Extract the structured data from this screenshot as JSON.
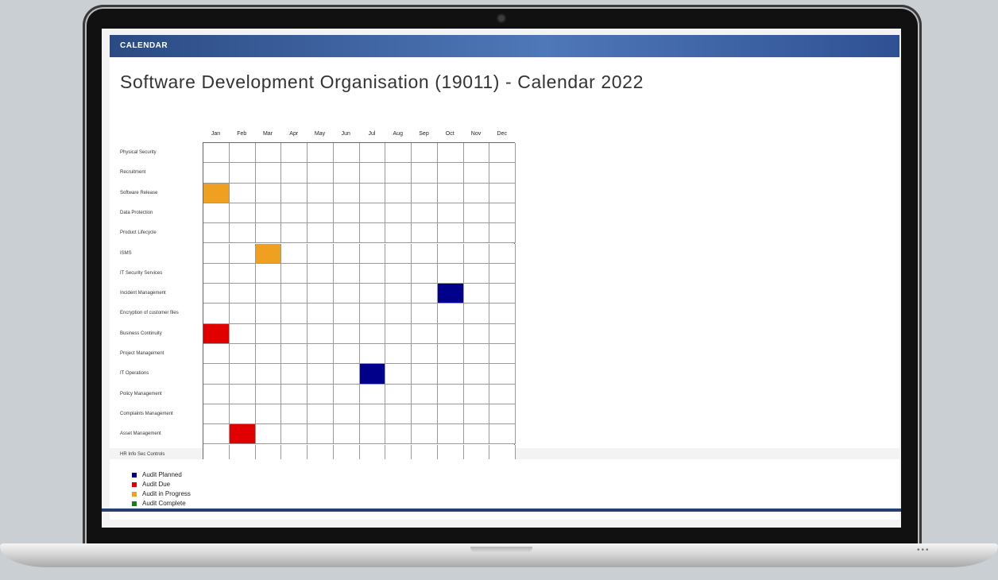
{
  "header": {
    "label": "CALENDAR"
  },
  "page": {
    "title": "Software Development Organisation (19011) - Calendar 2022"
  },
  "colors": {
    "planned": "#00008b",
    "due": "#e00000",
    "in_progress": "#f0a020",
    "complete": "#1f7a1f",
    "empty": "#ffffff"
  },
  "calendar": {
    "months": [
      "Jan",
      "Feb",
      "Mar",
      "Apr",
      "May",
      "Jun",
      "Jul",
      "Aug",
      "Sep",
      "Oct",
      "Nov",
      "Dec"
    ],
    "rows": [
      {
        "label": "Physical Security",
        "cells": [
          "",
          "",
          "",
          "",
          "",
          "",
          "",
          "",
          "",
          "",
          "",
          ""
        ]
      },
      {
        "label": "Recruitment",
        "cells": [
          "",
          "",
          "",
          "",
          "",
          "",
          "",
          "",
          "",
          "",
          "",
          ""
        ]
      },
      {
        "label": "Software Release",
        "cells": [
          "in_progress",
          "",
          "",
          "",
          "",
          "",
          "",
          "",
          "",
          "",
          "",
          ""
        ]
      },
      {
        "label": "Data Protection",
        "cells": [
          "",
          "",
          "",
          "",
          "",
          "",
          "",
          "",
          "",
          "",
          "",
          ""
        ]
      },
      {
        "label": "Product Lifecycle",
        "cells": [
          "",
          "",
          "",
          "",
          "",
          "",
          "",
          "",
          "",
          "",
          "",
          ""
        ]
      },
      {
        "label": "ISMS",
        "cells": [
          "",
          "",
          "in_progress",
          "",
          "",
          "",
          "",
          "",
          "",
          "",
          "",
          ""
        ]
      },
      {
        "label": "IT Security Services",
        "cells": [
          "",
          "",
          "",
          "",
          "",
          "",
          "",
          "",
          "",
          "",
          "",
          ""
        ]
      },
      {
        "label": "Incident Management",
        "cells": [
          "",
          "",
          "",
          "",
          "",
          "",
          "",
          "",
          "",
          "planned",
          "",
          ""
        ]
      },
      {
        "label": "Encryption of customer files",
        "cells": [
          "",
          "",
          "",
          "",
          "",
          "",
          "",
          "",
          "",
          "",
          "",
          ""
        ]
      },
      {
        "label": "Business Continuity",
        "cells": [
          "due",
          "",
          "",
          "",
          "",
          "",
          "",
          "",
          "",
          "",
          "",
          ""
        ]
      },
      {
        "label": "Project Management",
        "cells": [
          "",
          "",
          "",
          "",
          "",
          "",
          "",
          "",
          "",
          "",
          "",
          ""
        ]
      },
      {
        "label": "IT Operations",
        "cells": [
          "",
          "",
          "",
          "",
          "",
          "",
          "planned",
          "",
          "",
          "",
          "",
          ""
        ]
      },
      {
        "label": "Policy Management",
        "cells": [
          "",
          "",
          "",
          "",
          "",
          "",
          "",
          "",
          "",
          "",
          "",
          ""
        ]
      },
      {
        "label": "Complaints Management",
        "cells": [
          "",
          "",
          "",
          "",
          "",
          "",
          "",
          "",
          "",
          "",
          "",
          ""
        ]
      },
      {
        "label": "Asset Management",
        "cells": [
          "",
          "due",
          "",
          "",
          "",
          "",
          "",
          "",
          "",
          "",
          "",
          ""
        ]
      },
      {
        "label": "HR Info Sec Controls",
        "cells": [
          "",
          "",
          "",
          "",
          "",
          "",
          "",
          "",
          "",
          "",
          "",
          ""
        ]
      }
    ]
  },
  "legend": {
    "items": [
      {
        "key": "planned",
        "label": "Audit Planned"
      },
      {
        "key": "due",
        "label": "Audit Due"
      },
      {
        "key": "in_progress",
        "label": "Audit in Progress"
      },
      {
        "key": "complete",
        "label": "Audit Complete"
      }
    ]
  }
}
